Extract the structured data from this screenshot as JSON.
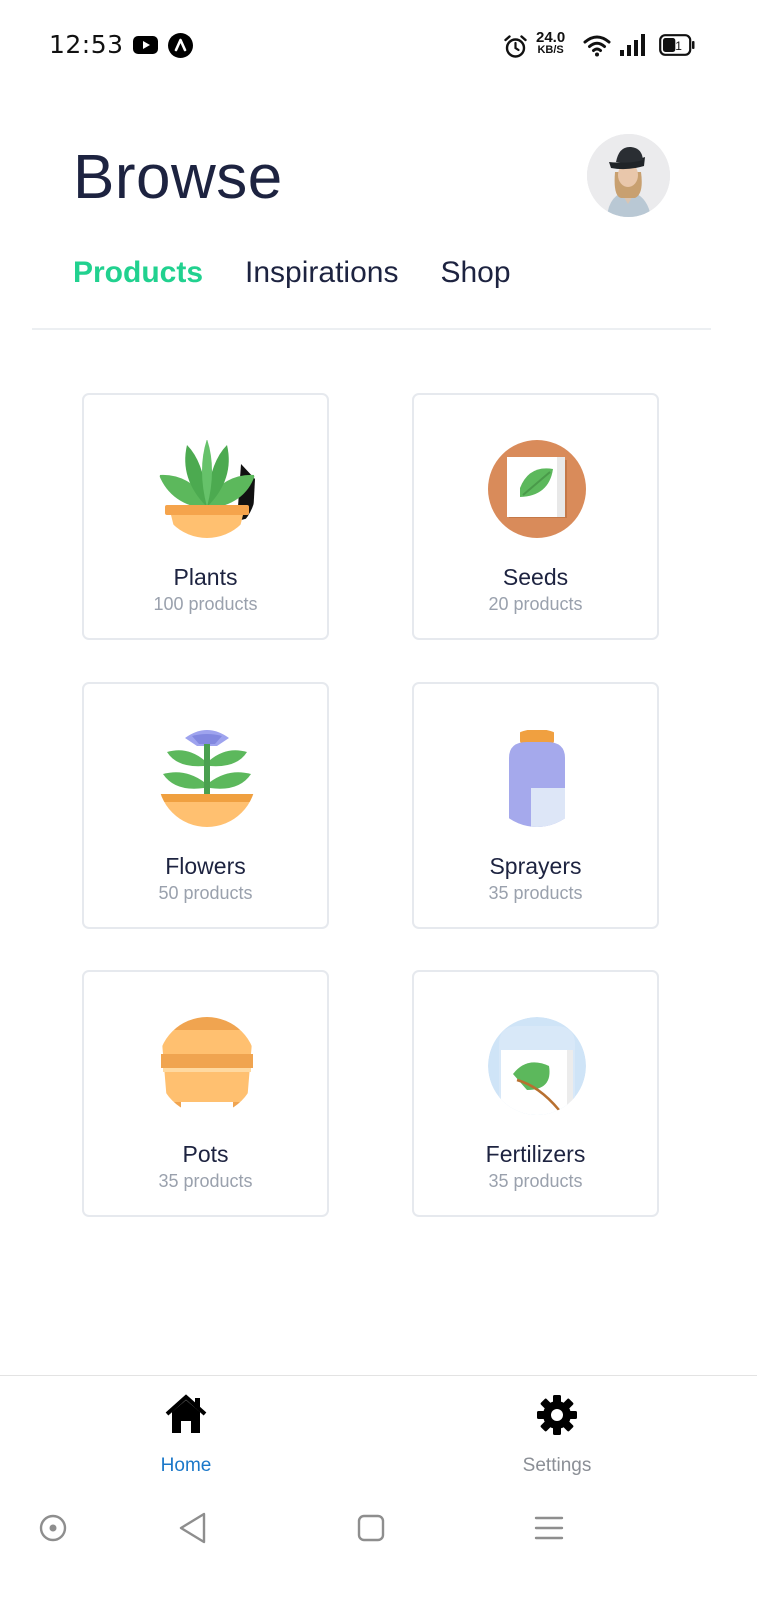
{
  "status_bar": {
    "time": "12:53",
    "net_speed_value": "24.0",
    "net_speed_unit": "KB/S",
    "battery_level": "41",
    "icons": [
      "youtube-icon",
      "app-notification-icon",
      "alarm-icon",
      "wifi-icon",
      "signal-icon",
      "battery-icon"
    ]
  },
  "header": {
    "title": "Browse",
    "avatar": "user-avatar"
  },
  "tabs": [
    {
      "label": "Products",
      "active": true
    },
    {
      "label": "Inspirations",
      "active": false
    },
    {
      "label": "Shop",
      "active": false
    }
  ],
  "categories": [
    {
      "name": "Plants",
      "count": "100 products",
      "icon": "plant-icon"
    },
    {
      "name": "Seeds",
      "count": "20 products",
      "icon": "seed-packet-icon"
    },
    {
      "name": "Flowers",
      "count": "50 products",
      "icon": "flower-pot-icon"
    },
    {
      "name": "Sprayers",
      "count": "35 products",
      "icon": "sprayer-icon"
    },
    {
      "name": "Pots",
      "count": "35 products",
      "icon": "pot-icon"
    },
    {
      "name": "Fertilizers",
      "count": "35 products",
      "icon": "fertilizer-icon"
    }
  ],
  "bottom_nav": {
    "home_label": "Home",
    "settings_label": "Settings"
  },
  "colors": {
    "accent": "#21d18f",
    "title": "#1d2340",
    "nav_active": "#1b78c9",
    "nav_inactive": "#8b8f96",
    "muted_text": "#9aa1ad",
    "card_border": "#e6e9ee"
  }
}
